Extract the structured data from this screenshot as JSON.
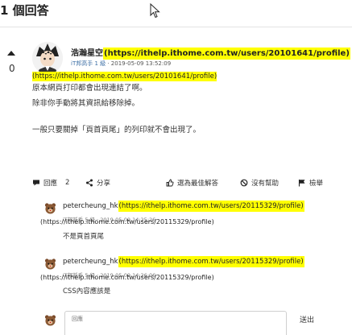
{
  "section": {
    "title": "1 個回答"
  },
  "answer": {
    "vote_count": "0",
    "author_name": "浩瀚星空",
    "author_url": "(https://ithelp.ithome.com.tw/users/20101641/profile)",
    "rank": "iT邦高手 1 級",
    "timestamp": "· 2019-05-09 13:52:09",
    "url_line": "(https://ithelp.ithome.com.tw/users/20101641/profile)",
    "body": [
      "原本網頁打印都會出現連結了啊。",
      "除非你手動將其資訊給移除掉。",
      "一般只要關掉「頁首頁尾」的列印就不會出現了。"
    ]
  },
  "actions": {
    "reply_label": "回應",
    "reply_count": "2",
    "share_label": "分享",
    "best_label": "選為最佳解答",
    "unhelpful_label": "沒有幫助",
    "report_label": "檢舉"
  },
  "comments": [
    {
      "author": "petercheung_hk",
      "author_url": "(https://ithelp.ithome.com.tw/users/20115329/profile)",
      "meta": "iT邦新手 5 級 · 2019-05-09 14:25:26",
      "url_line": "(https://ithelp.ithome.com.tw/users/20115329/profile)",
      "text": "不是頁首頁尾"
    },
    {
      "author": "petercheung_hk",
      "author_url": "(https://ithelp.ithome.com.tw/users/20115329/profile)",
      "meta": "iT邦新手 5 級 · 2019-05-09 14:26:06",
      "url_line": "(https://ithelp.ithome.com.tw/users/20115329/profile)",
      "text": "CSS內容應該是"
    }
  ],
  "reply_form": {
    "placeholder": "回應",
    "send_label": "送出"
  },
  "colors": {
    "highlight": "#ffff00",
    "rank": "#3b6ea5"
  }
}
